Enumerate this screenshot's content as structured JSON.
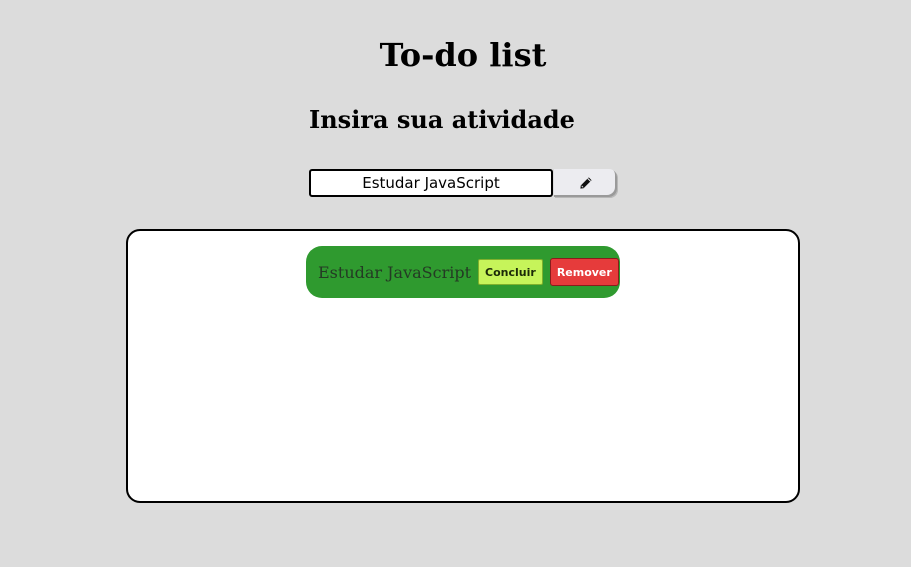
{
  "header": {
    "title": "To-do list",
    "subtitle": "Insira sua atividade"
  },
  "form": {
    "input_value": "Estudar JavaScript",
    "add_button_icon": "pencil-icon"
  },
  "tasks": [
    {
      "text": "Estudar JavaScript",
      "conclude_label": "Concluir",
      "remove_label": "Remover"
    }
  ],
  "colors": {
    "background": "#dcdcdc",
    "task_item": "#2f9a2f",
    "conclude": "#c6f45a",
    "remove": "#e63b3b"
  }
}
